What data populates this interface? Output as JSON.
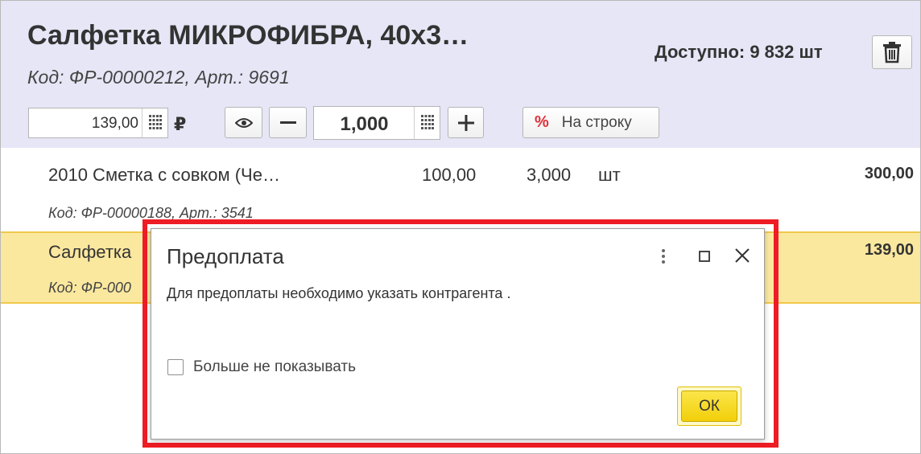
{
  "header": {
    "product_title": "Салфетка МИКРОФИБРА, 40х3…",
    "product_code": "Код: ФР-00000212, Арт.: 9691",
    "available_label": "Доступно: 9 832 шт",
    "price_value": "139,00",
    "currency_symbol": "₽",
    "quantity_value": "1,000",
    "row_button_label": "На строку",
    "percent_symbol": "%"
  },
  "list": {
    "rows": [
      {
        "name": "2010 Сметка с совком (Че…",
        "code": "Код: ФР-00000188, Арт.: 3541",
        "price": "100,00",
        "quantity": "3,000",
        "unit": "шт",
        "sum": "300,00"
      },
      {
        "name": "Салфетка ",
        "code": "Код: ФР-000",
        "sum": "139,00"
      }
    ]
  },
  "dialog": {
    "title": "Предоплата",
    "message": "Для предоплаты необходимо указать контрагента .",
    "checkbox_label": "Больше не показывать",
    "checkbox_checked": false,
    "ok_label": "ОК"
  },
  "colors": {
    "header_bg": "#e6e6f6",
    "selected_row_bg": "#fbe89f",
    "highlight_border": "#ee1c24",
    "ok_button": "#f2cf0a",
    "percent_icon": "#e0303a"
  },
  "icons": {
    "delete": "trash-icon",
    "calculator": "calculator-grid-icon",
    "view": "eye-icon",
    "decrement": "minus-icon",
    "increment": "plus-icon",
    "more": "more-vertical-icon",
    "maximize": "maximize-icon",
    "close": "close-icon"
  }
}
